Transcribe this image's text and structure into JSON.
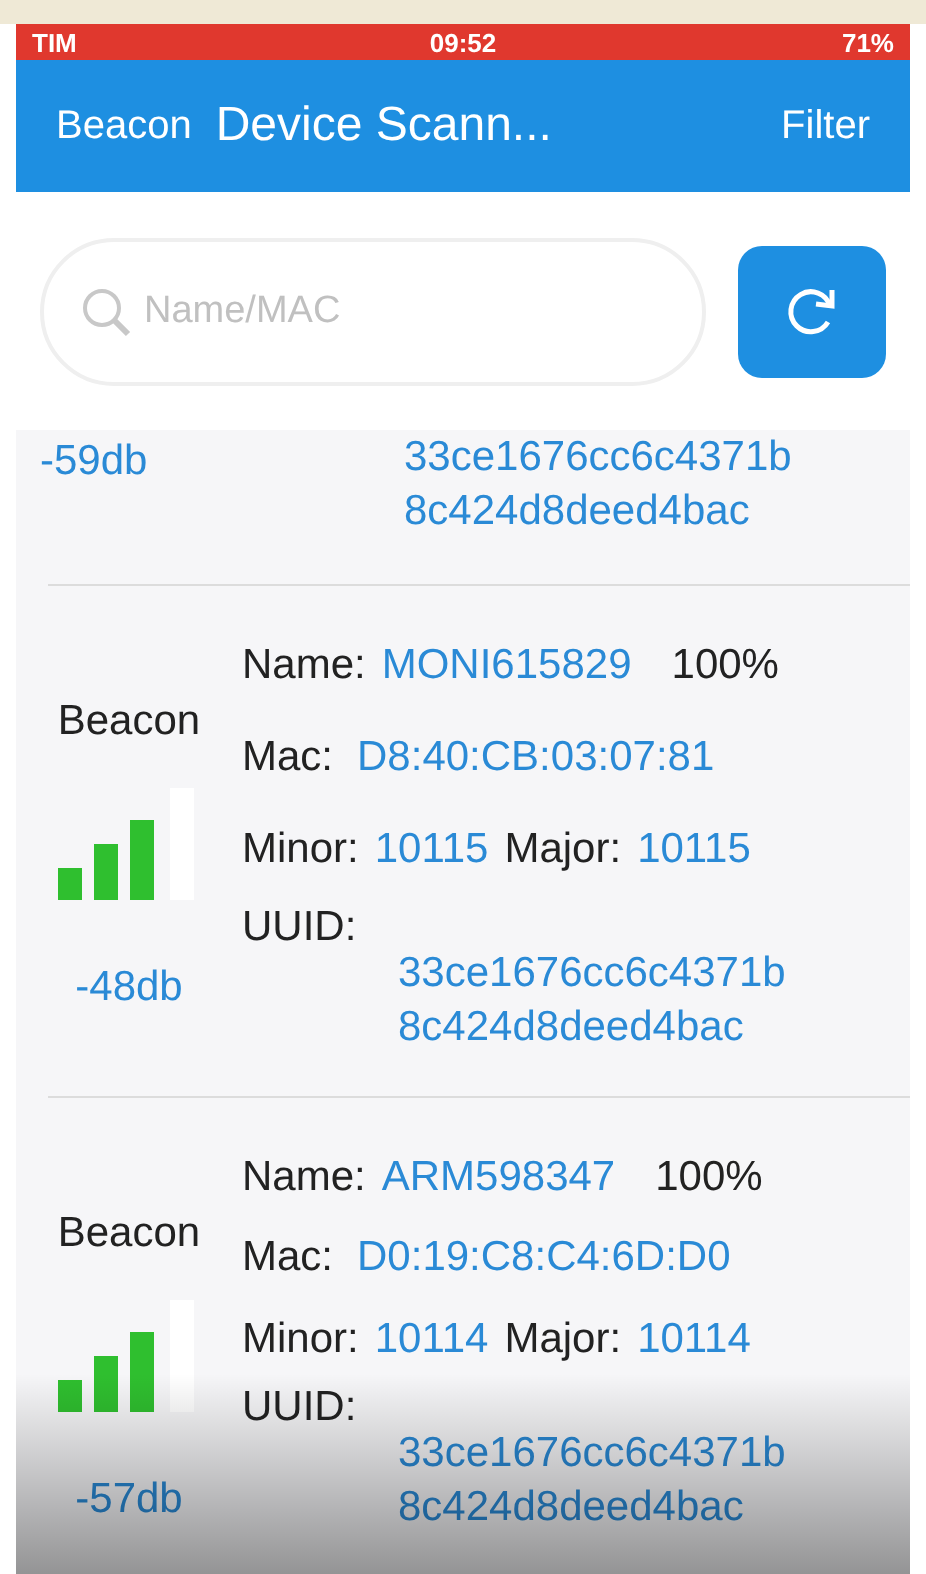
{
  "status_bar": {
    "carrier": "TIM",
    "time": "09:52",
    "battery": "71%"
  },
  "nav": {
    "back": "Beacon",
    "title": "Device Scann...",
    "action": "Filter"
  },
  "search": {
    "placeholder": "Name/MAC"
  },
  "partial_row": {
    "rssi": "-59db",
    "uuid_lines": [
      "33ce1676cc6c4371b",
      "8c424d8deed4bac"
    ]
  },
  "devices": [
    {
      "type": "Beacon",
      "rssi": "-48db",
      "name_label": "Name:",
      "name": "MONI615829",
      "battery": "100%",
      "mac_label": "Mac:",
      "mac": "D8:40:CB:03:07:81",
      "minor_label": "Minor:",
      "minor": "10115",
      "major_label": "Major:",
      "major": "10115",
      "uuid_label": "UUID:",
      "uuid_lines": [
        "33ce1676cc6c4371b",
        "8c424d8deed4bac"
      ]
    },
    {
      "type": "Beacon",
      "rssi": "-57db",
      "name_label": "Name:",
      "name": "ARM598347",
      "battery": "100%",
      "mac_label": "Mac:",
      "mac": "D0:19:C8:C4:6D:D0",
      "minor_label": "Minor:",
      "minor": "10114",
      "major_label": "Major:",
      "major": "10114",
      "uuid_label": "UUID:",
      "uuid_lines": [
        "33ce1676cc6c4371b",
        "8c424d8deed4bac"
      ]
    }
  ]
}
